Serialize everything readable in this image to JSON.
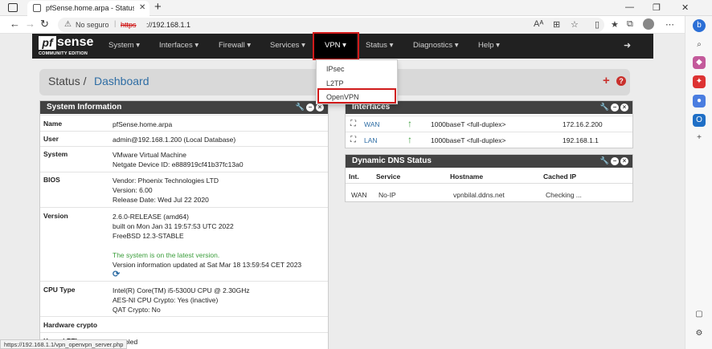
{
  "browser": {
    "tab_title": "pfSense.home.arpa - Status: Dash",
    "tab_close": "✕",
    "new_tab": "+",
    "window_controls": [
      "—",
      "❐",
      "✕"
    ],
    "nav": {
      "back": "←",
      "forward": "→",
      "reload": "↻"
    },
    "security_label": "No seguro",
    "url_scheme": "https",
    "url_host": "://192.168.1.1",
    "status_url": "https://192.168.1.1/vpn_openvpn_server.php"
  },
  "navbar": {
    "logo_pf": "pf",
    "logo_sense": "sense",
    "logo_edition": "COMMUNITY EDITION",
    "menus": [
      "System ▾",
      "Interfaces ▾",
      "Firewall ▾",
      "Services ▾",
      "VPN ▾",
      "Status ▾",
      "Diagnostics ▾",
      "Help ▾"
    ],
    "logout_icon": "➜"
  },
  "vpn_menu": {
    "items": [
      "IPsec",
      "L2TP",
      "OpenVPN"
    ]
  },
  "breadcrumb": {
    "section": "Status /",
    "page": "Dashboard"
  },
  "system_info": {
    "title": "System Information",
    "rows": [
      {
        "label": "Name",
        "lines": [
          "pfSense.home.arpa"
        ]
      },
      {
        "label": "User",
        "lines": [
          "admin@192.168.1.200 (Local Database)"
        ]
      },
      {
        "label": "System",
        "lines": [
          "VMware Virtual Machine",
          "Netgate Device ID: e888919cf41b37fc13a0"
        ]
      },
      {
        "label": "BIOS",
        "lines": [
          "Vendor: Phoenix Technologies LTD",
          "Version: 6.00",
          "Release Date: Wed Jul 22 2020"
        ]
      },
      {
        "label": "Version",
        "lines": [
          "2.6.0-RELEASE (amd64)",
          "built on Mon Jan 31 19:57:53 UTC 2022",
          "FreeBSD 12.3-STABLE",
          "",
          "The system is on the latest version.",
          "Version information updated at Sat Mar 18 13:59:54 CET 2023"
        ]
      },
      {
        "label": "CPU Type",
        "lines": [
          "Intel(R) Core(TM) i5-5300U CPU @ 2.30GHz",
          "AES-NI CPU Crypto: Yes (inactive)",
          "QAT Crypto: No"
        ]
      },
      {
        "label": "Hardware crypto",
        "lines": []
      },
      {
        "label": "Kernel PTI",
        "lines": [
          "Enabled"
        ]
      }
    ]
  },
  "interfaces": {
    "title": "Interfaces",
    "rows": [
      {
        "name": "WAN",
        "speed": "1000baseT <full-duplex>",
        "ip": "172.16.2.200"
      },
      {
        "name": "LAN",
        "speed": "1000baseT <full-duplex>",
        "ip": "192.168.1.1"
      }
    ]
  },
  "ddns": {
    "title": "Dynamic DNS Status",
    "headers": [
      "Int.",
      "Service",
      "Hostname",
      "Cached IP"
    ],
    "row": [
      "WAN",
      "No-IP",
      "vpnbilal.ddns.net",
      "Checking ..."
    ]
  },
  "colors": {
    "navbar": "#212121",
    "accent_red": "#c9302c",
    "link_blue": "#2e6da4",
    "ok_green": "#3a9d3a"
  }
}
